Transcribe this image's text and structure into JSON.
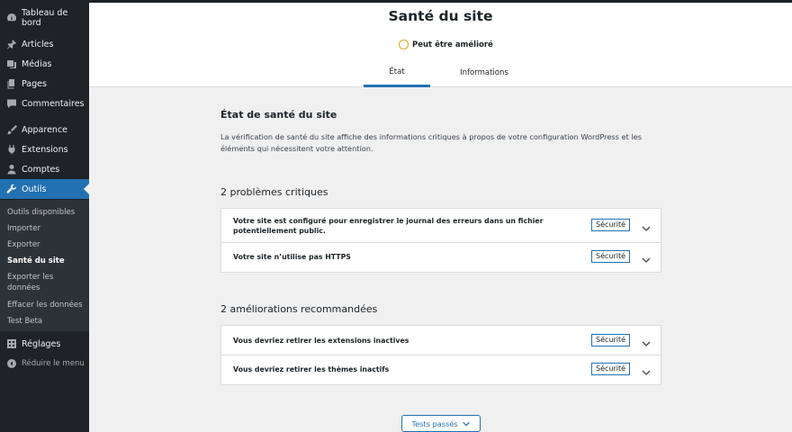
{
  "sidebar": {
    "items": [
      {
        "label": "Tableau de bord",
        "icon": "dashboard-icon"
      },
      {
        "label": "Articles",
        "icon": "pin-icon"
      },
      {
        "label": "Médias",
        "icon": "media-icon"
      },
      {
        "label": "Pages",
        "icon": "page-icon"
      },
      {
        "label": "Commentaires",
        "icon": "comment-icon"
      },
      {
        "label": "Apparence",
        "icon": "brush-icon"
      },
      {
        "label": "Extensions",
        "icon": "plugin-icon"
      },
      {
        "label": "Comptes",
        "icon": "user-icon"
      },
      {
        "label": "Outils",
        "icon": "wrench-icon"
      },
      {
        "label": "Réglages",
        "icon": "settings-icon"
      },
      {
        "label": "Réduire le menu",
        "icon": "collapse-icon"
      }
    ],
    "submenu": [
      {
        "label": "Outils disponibles"
      },
      {
        "label": "Importer"
      },
      {
        "label": "Exporter"
      },
      {
        "label": "Santé du site"
      },
      {
        "label": "Exporter les données"
      },
      {
        "label": "Effacer les données"
      },
      {
        "label": "Test Beta"
      }
    ],
    "current_color": "#2271b1"
  },
  "header": {
    "title": "Santé du site",
    "status": "Peut être amélioré",
    "status_color": "#dba617",
    "tabs": [
      {
        "label": "État"
      },
      {
        "label": "Informations"
      }
    ]
  },
  "main": {
    "title": "État de santé du site",
    "description": "La vérification de santé du site affiche des informations critiques à propos de votre configuration WordPress et les éléments qui nécessitent votre attention.",
    "groups": [
      {
        "title": "2 problèmes critiques",
        "items": [
          {
            "text": "Votre site est configuré pour enregistrer le journal des erreurs dans un fichier potentiellement public.",
            "badge": "Sécurité"
          },
          {
            "text": "Votre site n’utilise pas HTTPS",
            "badge": "Sécurité"
          }
        ]
      },
      {
        "title": "2 améliorations recommandées",
        "items": [
          {
            "text": "Vous devriez retirer les extensions inactives",
            "badge": "Sécurité"
          },
          {
            "text": "Vous devriez retirer les thèmes inactifs",
            "badge": "Sécurité"
          }
        ]
      }
    ],
    "passed_button": "Tests passés"
  }
}
